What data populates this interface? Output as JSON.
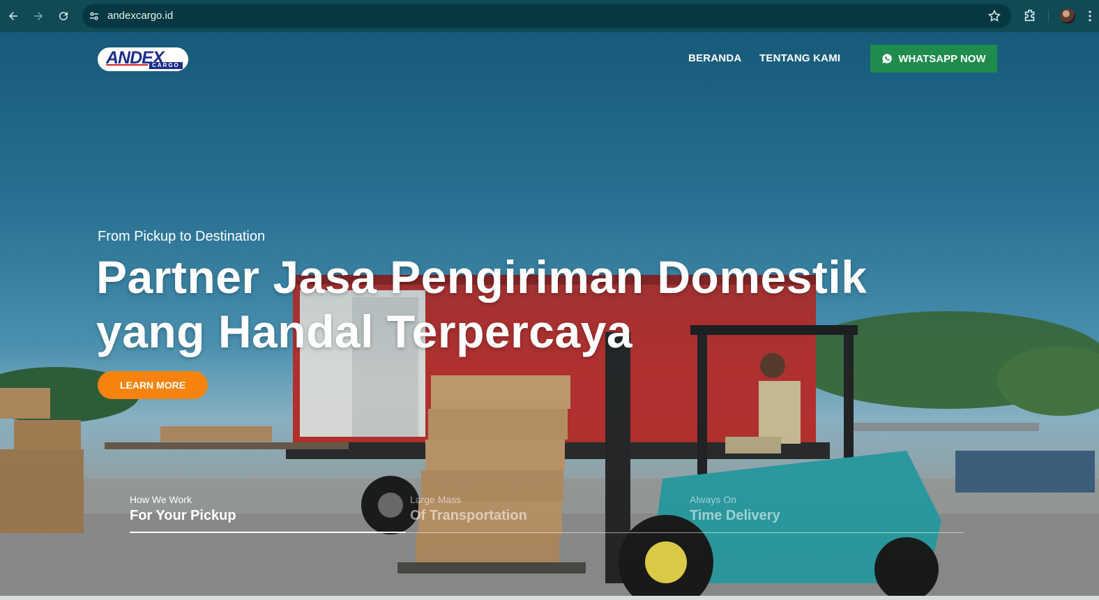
{
  "browser": {
    "url": "andexcargo.id",
    "icons": [
      "back-icon",
      "forward-icon",
      "reload-icon",
      "site-settings-icon",
      "bookmark-star-icon",
      "extensions-icon",
      "profile-avatar",
      "menu-icon"
    ]
  },
  "header": {
    "logo": {
      "main": "ANDEX",
      "sub": "CARGO"
    },
    "nav": [
      {
        "label": "BERANDA"
      },
      {
        "label": "TENTANG KAMI"
      }
    ],
    "cta": {
      "label": "WHATSAPP NOW",
      "icon": "whatsapp-icon",
      "color": "#1f8b4c"
    }
  },
  "hero": {
    "kicker": "From Pickup to Destination",
    "headline_line1": "Partner Jasa Pengiriman Domestik",
    "headline_line2": "yang Handal Terpercaya",
    "button": {
      "label": "LEARN MORE",
      "color": "#f5830e"
    }
  },
  "features": [
    {
      "small": "How We Work",
      "big": "For Your Pickup",
      "active": true
    },
    {
      "small": "Large Mass",
      "big": "Of Transportation",
      "active": false
    },
    {
      "small": "Always On",
      "big": "Time Delivery",
      "active": false
    }
  ],
  "slider": {
    "progress_fraction": 0.33
  }
}
